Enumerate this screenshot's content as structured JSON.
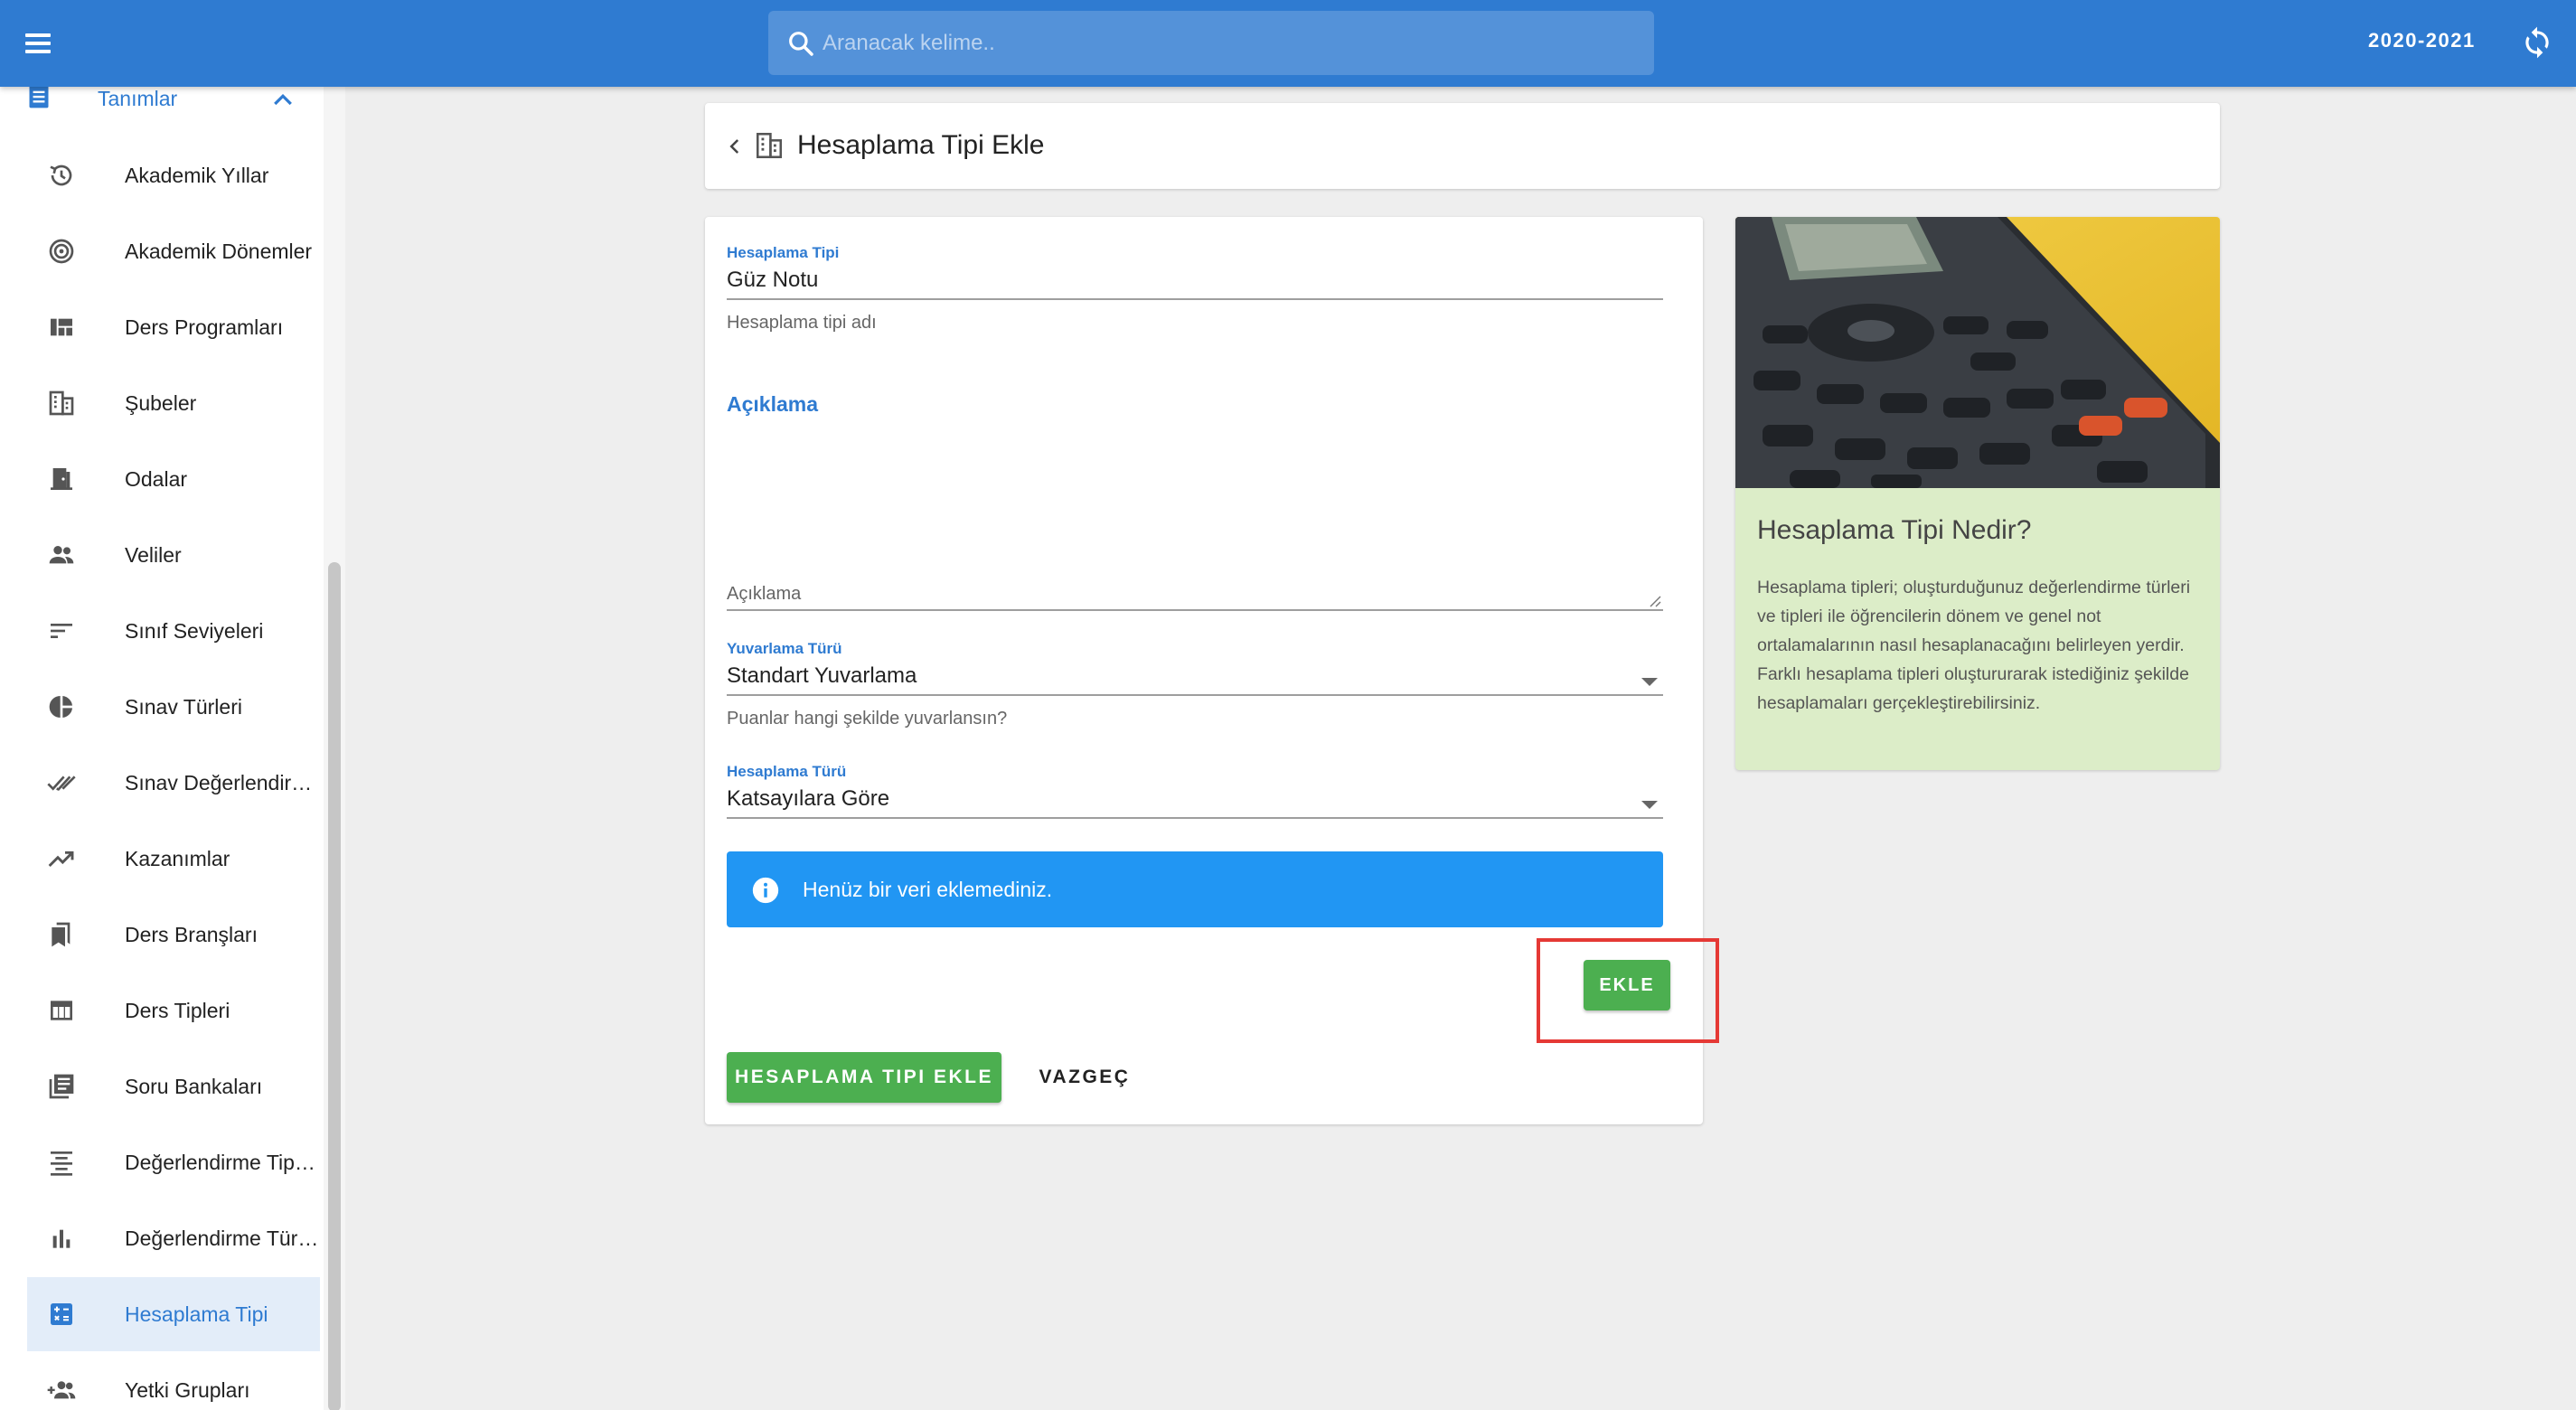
{
  "topbar": {
    "search_placeholder": "Aranacak kelime..",
    "year": "2020-2021"
  },
  "sidebar": {
    "group_label": "Tanımlar",
    "items": [
      {
        "label": "Akademik Yıllar",
        "icon": "history-icon"
      },
      {
        "label": "Akademik Dönemler",
        "icon": "target-icon"
      },
      {
        "label": "Ders Programları",
        "icon": "dashboard-icon"
      },
      {
        "label": "Şubeler",
        "icon": "building-icon"
      },
      {
        "label": "Odalar",
        "icon": "door-icon"
      },
      {
        "label": "Veliler",
        "icon": "people-icon"
      },
      {
        "label": "Sınıf Seviyeleri",
        "icon": "sort-icon"
      },
      {
        "label": "Sınav Türleri",
        "icon": "pie-chart-icon"
      },
      {
        "label": "Sınav Değerlendirme",
        "icon": "double-check-icon"
      },
      {
        "label": "Kazanımlar",
        "icon": "trending-up-icon"
      },
      {
        "label": "Ders Branşları",
        "icon": "bookmarks-icon"
      },
      {
        "label": "Ders Tipleri",
        "icon": "table-icon"
      },
      {
        "label": "Soru Bankaları",
        "icon": "library-books-icon"
      },
      {
        "label": "Değerlendirme Tipleri",
        "icon": "align-center-icon"
      },
      {
        "label": "Değerlendirme Türleri",
        "icon": "bar-chart-icon"
      },
      {
        "label": "Hesaplama Tipi",
        "icon": "calculator-icon",
        "active": true
      },
      {
        "label": "Yetki Grupları",
        "icon": "group-add-icon"
      }
    ]
  },
  "header": {
    "title": "Hesaplama Tipi Ekle"
  },
  "form": {
    "type_label": "Hesaplama Tipi",
    "type_value": "Güz Notu",
    "type_hint": "Hesaplama tipi adı",
    "desc_label": "Açıklama",
    "desc_hint": "Açıklama",
    "rounding_label": "Yuvarlama Türü",
    "rounding_value": "Standart Yuvarlama",
    "rounding_hint": "Puanlar hangi şekilde yuvarlansın?",
    "calc_label": "Hesaplama Türü",
    "calc_value": "Katsayılara Göre",
    "alert_text": "Henüz bir veri eklemediniz.",
    "add_button": "EKLE",
    "submit_button": "HESAPLAMA TIPI EKLE",
    "cancel_button": "VAZGEÇ"
  },
  "info": {
    "title": "Hesaplama Tipi Nedir?",
    "body": "Hesaplama tipleri; oluşturduğunuz değerlendirme türleri ve tipleri ile öğrencilerin dönem ve genel not ortalamalarının nasıl hesaplanacağını belirleyen yerdir. Farklı hesaplama tipleri oluştururarak istediğiniz şekilde hesaplamaları gerçekleştirebilirsiniz."
  },
  "colors": {
    "primary": "#2f7bd1",
    "success": "#4caf50",
    "info": "#2196f3",
    "highlight": "#e53935",
    "info_card_bg": "#dcedc8"
  }
}
